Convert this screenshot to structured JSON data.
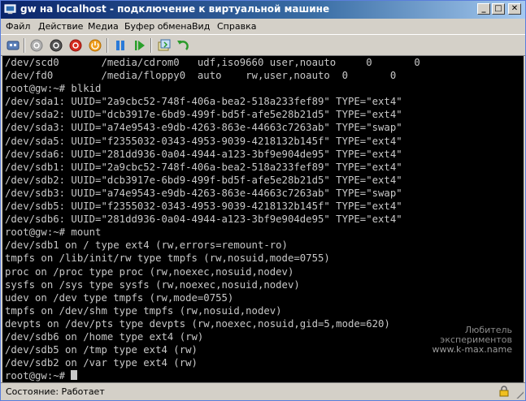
{
  "window": {
    "title": "gw на localhost - подключение к виртуальной машине",
    "min_label": "_",
    "max_label": "□",
    "close_label": "✕"
  },
  "menu": [
    "Файл",
    "Действие",
    "Медиа",
    "Буфер обмена",
    "Вид",
    "Справка"
  ],
  "toolbar_icons": [
    "ctrl-alt-del-icon",
    "start-icon",
    "turn-off-icon",
    "shutdown-icon",
    "power-icon",
    "pause-icon",
    "resume-icon",
    "snapshot-icon",
    "revert-icon"
  ],
  "colors": {
    "terminal_bg": "#000000",
    "terminal_fg": "#c8c8c8",
    "title_gradient_start": "#0a246a"
  },
  "console": {
    "lines": [
      "/dev/scd0       /media/cdrom0   udf,iso9660 user,noauto     0       0",
      "/dev/fd0        /media/floppy0  auto    rw,user,noauto  0       0",
      "root@gw:~# blkid",
      "/dev/sda1: UUID=\"2a9cbc52-748f-406a-bea2-518a233fef89\" TYPE=\"ext4\"",
      "/dev/sda2: UUID=\"dcb3917e-6bd9-499f-bd5f-afe5e28b21d5\" TYPE=\"ext4\"",
      "/dev/sda3: UUID=\"a74e9543-e9db-4263-863e-44663c7263ab\" TYPE=\"swap\"",
      "/dev/sda5: UUID=\"f2355032-0343-4953-9039-4218132b145f\" TYPE=\"ext4\"",
      "/dev/sda6: UUID=\"281dd936-0a04-4944-a123-3bf9e904de95\" TYPE=\"ext4\"",
      "/dev/sdb1: UUID=\"2a9cbc52-748f-406a-bea2-518a233fef89\" TYPE=\"ext4\"",
      "/dev/sdb2: UUID=\"dcb3917e-6bd9-499f-bd5f-afe5e28b21d5\" TYPE=\"ext4\"",
      "/dev/sdb3: UUID=\"a74e9543-e9db-4263-863e-44663c7263ab\" TYPE=\"swap\"",
      "/dev/sdb5: UUID=\"f2355032-0343-4953-9039-4218132b145f\" TYPE=\"ext4\"",
      "/dev/sdb6: UUID=\"281dd936-0a04-4944-a123-3bf9e904de95\" TYPE=\"ext4\"",
      "root@gw:~# mount",
      "/dev/sdb1 on / type ext4 (rw,errors=remount-ro)",
      "tmpfs on /lib/init/rw type tmpfs (rw,nosuid,mode=0755)",
      "proc on /proc type proc (rw,noexec,nosuid,nodev)",
      "sysfs on /sys type sysfs (rw,noexec,nosuid,nodev)",
      "udev on /dev type tmpfs (rw,mode=0755)",
      "tmpfs on /dev/shm type tmpfs (rw,nosuid,nodev)",
      "devpts on /dev/pts type devpts (rw,noexec,nosuid,gid=5,mode=620)",
      "/dev/sdb6 on /home type ext4 (rw)",
      "/dev/sdb5 on /tmp type ext4 (rw)",
      "/dev/sdb2 on /var type ext4 (rw)"
    ],
    "prompt": "root@gw:~# "
  },
  "watermark": {
    "line1": "Любитель",
    "line2": "экспериментов",
    "line3": "www.k-max.name"
  },
  "status": {
    "text": "Состояние: Работает"
  }
}
